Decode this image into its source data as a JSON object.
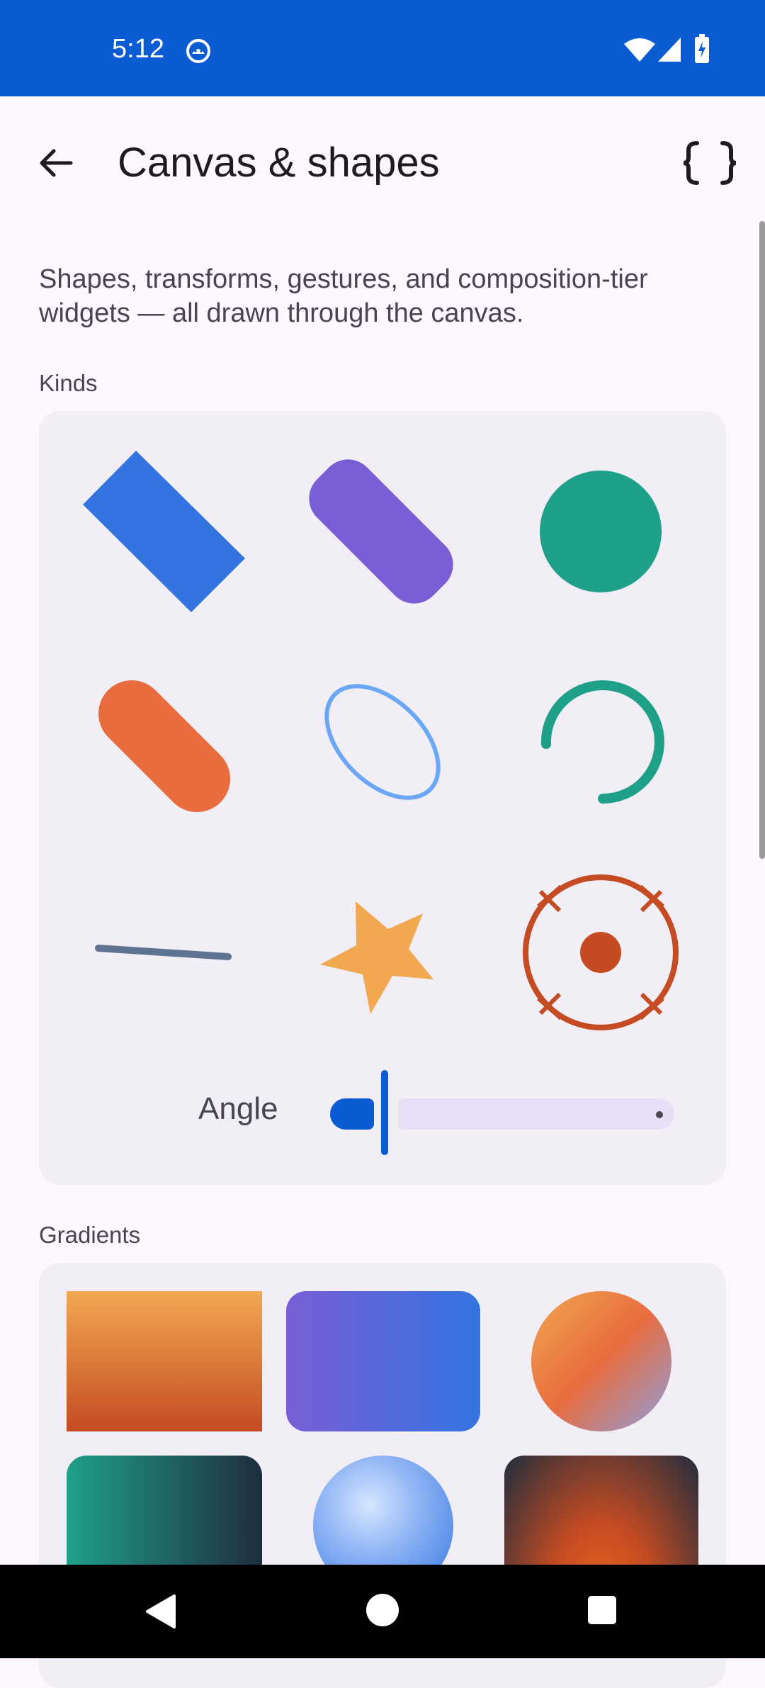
{
  "status_bar": {
    "time": "5:12",
    "icons": [
      "android-debug-icon",
      "wifi-icon",
      "cell-signal-icon",
      "battery-charging-icon"
    ]
  },
  "app_bar": {
    "title": "Canvas & shapes",
    "back_icon": "arrow-back-icon",
    "action_icon": "code-braces-icon"
  },
  "description": "Shapes, transforms, gestures, and composition-tier widgets — all drawn through the canvas.",
  "kinds": {
    "label": "Kinds",
    "shapes": [
      {
        "name": "rectangle",
        "color": "#3374E0"
      },
      {
        "name": "rounded-rectangle",
        "color": "#7A5ED6"
      },
      {
        "name": "circle",
        "color": "#1FA089"
      },
      {
        "name": "capsule",
        "color": "#E86C3E"
      },
      {
        "name": "oval-outline",
        "color": "#6AA8F5"
      },
      {
        "name": "arc",
        "color": "#1FA089"
      },
      {
        "name": "line",
        "color": "#5E7391"
      },
      {
        "name": "star",
        "color": "#F2A851"
      },
      {
        "name": "crosshair-target",
        "color": "#C44B22"
      }
    ],
    "angle_label": "Angle",
    "angle_value": 0
  },
  "gradients": {
    "label": "Gradients",
    "swatches": [
      {
        "name": "vertical-linear-orange",
        "colors": [
          "#F2A851",
          "#C44B22"
        ]
      },
      {
        "name": "horizontal-linear-violet-blue",
        "colors": [
          "#7A5ED6",
          "#3374E0"
        ]
      },
      {
        "name": "diagonal-sweep-circle",
        "colors": [
          "#F2A851",
          "#E86C3E",
          "#8CA0E0"
        ]
      },
      {
        "name": "horizontal-linear-teal-navy",
        "colors": [
          "#1FA089",
          "#1F2D3D"
        ]
      },
      {
        "name": "radial-blue-sphere",
        "colors": [
          "#D7E6FF",
          "#3374E0"
        ]
      },
      {
        "name": "radial-ember",
        "colors": [
          "#F06A1E",
          "#1F2D3D"
        ]
      }
    ]
  },
  "nav_bar": {
    "back_icon": "nav-back-icon",
    "home_icon": "nav-home-icon",
    "recents_icon": "nav-recents-icon"
  }
}
